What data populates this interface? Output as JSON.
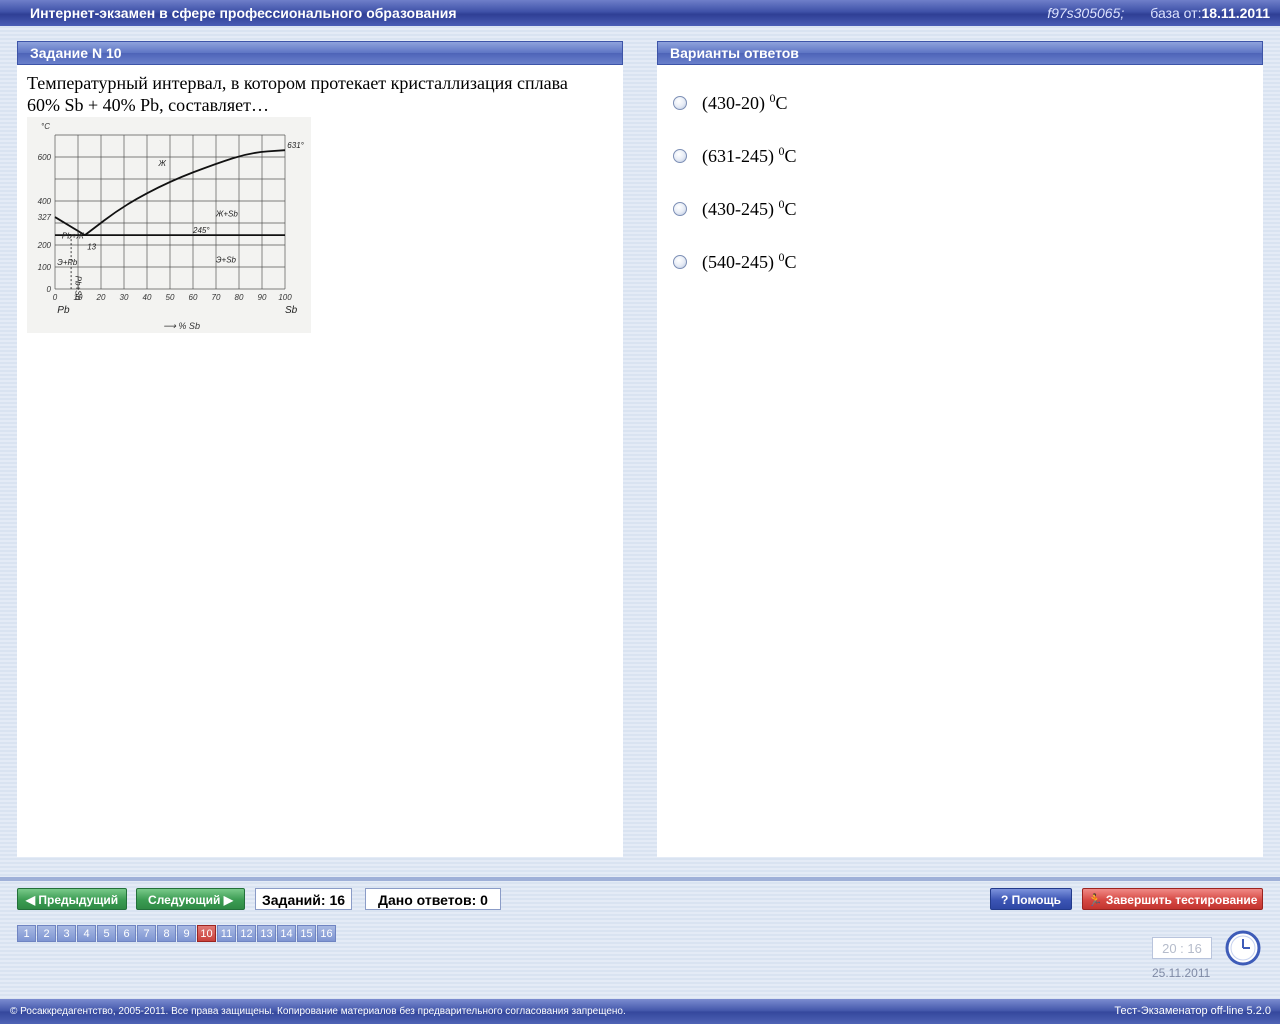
{
  "header": {
    "title": "Интернет-экзамен в сфере профессионального образования",
    "id": "f97s305065;",
    "base_label": "база от:",
    "base_date": "18.11.2011"
  },
  "task": {
    "heading": "Задание N 10",
    "question_line1": "Температурный интервал, в котором протекает кристаллизация сплава",
    "question_line2": "60% Sb + 40% Pb, составляет…"
  },
  "answers_panel": {
    "heading": "Варианты ответов",
    "options": [
      {
        "text": "(430-20) ",
        "sup": "0",
        "unit": "C"
      },
      {
        "text": "(631-245) ",
        "sup": "0",
        "unit": "C"
      },
      {
        "text": "(430-245) ",
        "sup": "0",
        "unit": "C"
      },
      {
        "text": "(540-245) ",
        "sup": "0",
        "unit": "C"
      }
    ]
  },
  "toolbar": {
    "prev_label": "Предыдущий",
    "next_label": "Следующий",
    "tasks_count": "Заданий: 16",
    "answers_given": "Дано ответов: 0",
    "help_label": "Помощь",
    "finish_label": "Завершить тестирование",
    "pages": [
      "1",
      "2",
      "3",
      "4",
      "5",
      "6",
      "7",
      "8",
      "9",
      "10",
      "11",
      "12",
      "13",
      "14",
      "15",
      "16"
    ],
    "active_page": "10",
    "timer": "20 : 16",
    "date": "25.11.2011"
  },
  "footer": {
    "copyright": "© Росаккредагентство, 2005-2011. Все права защищены. Копирование материалов без предварительного согласования запрещено.",
    "version": "Тест-Экзаменатор off-line 5.2.0"
  },
  "chart_data": {
    "type": "line",
    "title": "",
    "xlabel": "% Sb",
    "ylabel": "°C",
    "x_ticks": [
      "0",
      "10",
      "20",
      "30",
      "40",
      "50",
      "60",
      "70",
      "80",
      "90",
      "100"
    ],
    "y_ticks": [
      "0",
      "100",
      "200",
      "327",
      "400",
      "600"
    ],
    "xlim": [
      0,
      100
    ],
    "ylim": [
      0,
      700
    ],
    "liquidus_left": {
      "x": [
        0,
        13
      ],
      "y": [
        327,
        245
      ]
    },
    "liquidus_right": {
      "x": [
        13,
        30,
        50,
        70,
        85,
        100
      ],
      "y": [
        245,
        380,
        490,
        570,
        620,
        631
      ]
    },
    "eutectic_line": {
      "x": [
        0,
        100
      ],
      "y": [
        245,
        245
      ]
    },
    "annotations": [
      "Ж",
      "Ж+Sb",
      "245°",
      "Pb+Ж",
      "Э+Sb",
      "Э+Pb",
      "Pb+Sb",
      "13",
      "631°",
      "Pb",
      "Sb",
      "0",
      "327"
    ]
  }
}
